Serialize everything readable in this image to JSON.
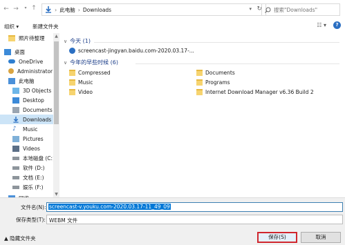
{
  "address": {
    "segments": [
      "此电脑",
      "Downloads"
    ],
    "search_placeholder": "搜索\"Downloads\""
  },
  "toolbar": {
    "organize": "组织 ▾",
    "new_folder": "新建文件夹"
  },
  "nav": {
    "items": [
      {
        "label": "照片待整理"
      },
      {
        "label": "桌面"
      },
      {
        "label": "OneDrive"
      },
      {
        "label": "Administrator"
      },
      {
        "label": "此电脑"
      },
      {
        "label": "3D Objects"
      },
      {
        "label": "Desktop"
      },
      {
        "label": "Documents"
      },
      {
        "label": "Downloads"
      },
      {
        "label": "Music"
      },
      {
        "label": "Pictures"
      },
      {
        "label": "Videos"
      },
      {
        "label": "本地磁盘 (C:)"
      },
      {
        "label": "软件 (D:)"
      },
      {
        "label": "文档 (E:)"
      },
      {
        "label": "娱乐 (F:)"
      },
      {
        "label": "网络"
      }
    ]
  },
  "content": {
    "group_today": "今天 (1)",
    "group_earlier": "今年的早些时候 (6)",
    "today_files": [
      "screencast-jingyan.baidu.com-2020.03.17-..."
    ],
    "earlier_files": [
      "Compressed",
      "Music",
      "Video",
      "Documents",
      "Programs",
      "Internet Download Manager v6.36 Build 2"
    ]
  },
  "bottom": {
    "filename_label": "文件名(N):",
    "filename_value": "screencast-v.youku.com-2020.03.17-11_49_09",
    "filetype_label": "保存类型(T):",
    "filetype_value": "WEBM 文件",
    "hide_folders": "▲ 隐藏文件夹",
    "save_label": "保存(S)",
    "cancel_label": "取消"
  }
}
